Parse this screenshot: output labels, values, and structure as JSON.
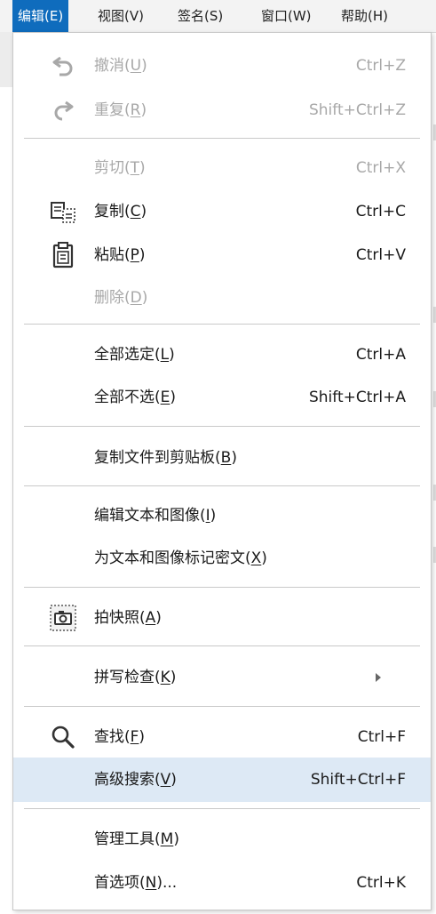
{
  "menubar": [
    {
      "label": "编辑(E)",
      "active": true
    },
    {
      "label": "视图(V)"
    },
    {
      "label": "签名(S)"
    },
    {
      "label": "窗口(W)"
    },
    {
      "label": "帮助(H)"
    }
  ],
  "colors": {
    "accent": "#0f6cbd",
    "highlight": "#dde9f5",
    "disabled": "#a8a8a8"
  },
  "items": {
    "undo": {
      "label": "撤消",
      "key": "U",
      "shortcut": "Ctrl+Z",
      "icon": "undo-arrow-icon",
      "disabled": true
    },
    "redo": {
      "label": "重复",
      "key": "R",
      "shortcut": "Shift+Ctrl+Z",
      "icon": "redo-arrow-icon",
      "disabled": true
    },
    "cut": {
      "label": "剪切",
      "key": "T",
      "shortcut": "Ctrl+X",
      "disabled": true
    },
    "copy": {
      "label": "复制",
      "key": "C",
      "shortcut": "Ctrl+C",
      "icon": "copy-icon"
    },
    "paste": {
      "label": "粘贴",
      "key": "P",
      "shortcut": "Ctrl+V",
      "icon": "clipboard-icon"
    },
    "delete": {
      "label": "删除",
      "key": "D",
      "disabled": true
    },
    "select_all": {
      "label": "全部选定",
      "key": "L",
      "shortcut": "Ctrl+A"
    },
    "deselect_all": {
      "label": "全部不选",
      "key": "E",
      "shortcut": "Shift+Ctrl+A"
    },
    "copy_file": {
      "label": "复制文件到剪贴板",
      "key": "B"
    },
    "edit_text_images": {
      "label": "编辑文本和图像",
      "key": "I"
    },
    "redact": {
      "label": "为文本和图像标记密文",
      "key": "X"
    },
    "snapshot": {
      "label": "拍快照",
      "key": "A",
      "icon": "camera-icon"
    },
    "spellcheck": {
      "label": "拼写检查",
      "key": "K",
      "submenu": true
    },
    "find": {
      "label": "查找",
      "key": "F",
      "shortcut": "Ctrl+F",
      "icon": "search-icon"
    },
    "advanced_search": {
      "label": "高级搜索",
      "key": "V",
      "shortcut": "Shift+Ctrl+F",
      "highlighted": true
    },
    "manage_tools": {
      "label": "管理工具",
      "key": "M"
    },
    "preferences": {
      "label": "首选项",
      "key": "N",
      "suffix": "...",
      "shortcut": "Ctrl+K"
    }
  }
}
